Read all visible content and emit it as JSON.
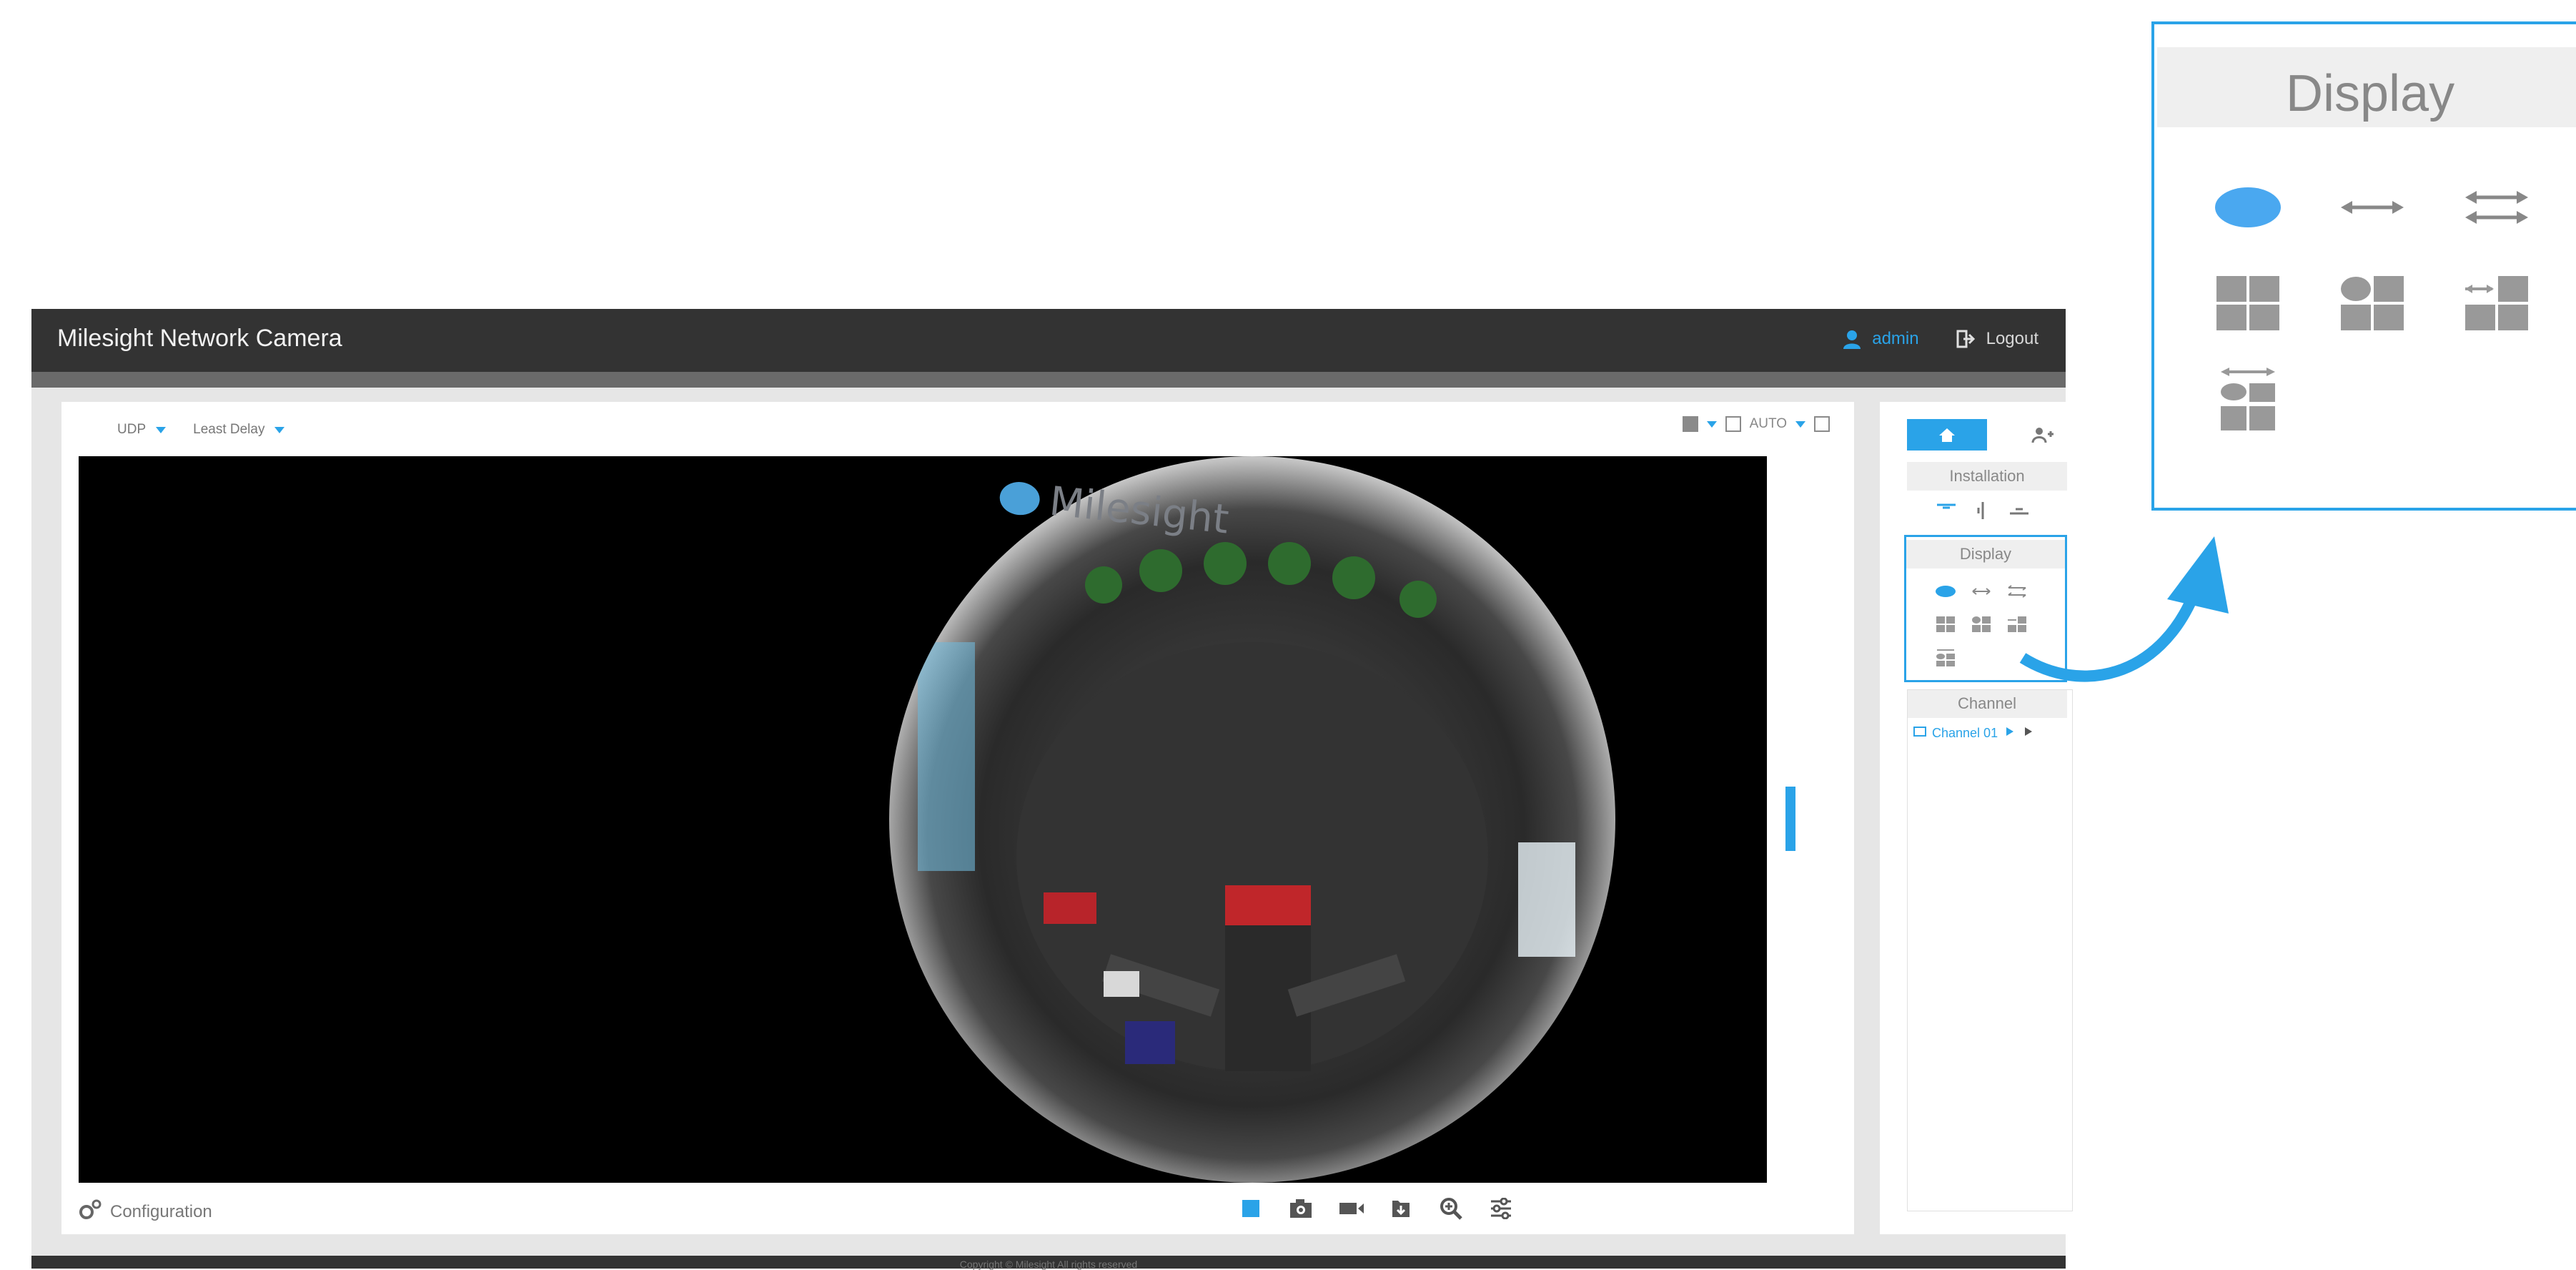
{
  "app": {
    "title": "Milesight Network Camera",
    "user_name": "admin",
    "logout_label": "Logout"
  },
  "stream": {
    "protocol": "UDP",
    "mode": "Least Delay"
  },
  "view_controls": {
    "scale_label": "AUTO"
  },
  "video": {
    "watermark_text": "Milesight"
  },
  "footer": {
    "config_label": "Configuration",
    "tools": [
      "stop-live-icon",
      "snapshot-icon",
      "record-icon",
      "save-icon",
      "zoom-icon",
      "settings-icon"
    ],
    "copyright": "Copyright © Milesight All rights reserved"
  },
  "side_panel": {
    "installation_label": "Installation",
    "display_label": "Display",
    "channel_label": "Channel",
    "channel_name": "Channel 01"
  },
  "callout": {
    "title": "Display"
  },
  "colors": {
    "accent": "#2aa3e8",
    "topbar": "#333333",
    "icon_gray": "#8a8a8a"
  }
}
